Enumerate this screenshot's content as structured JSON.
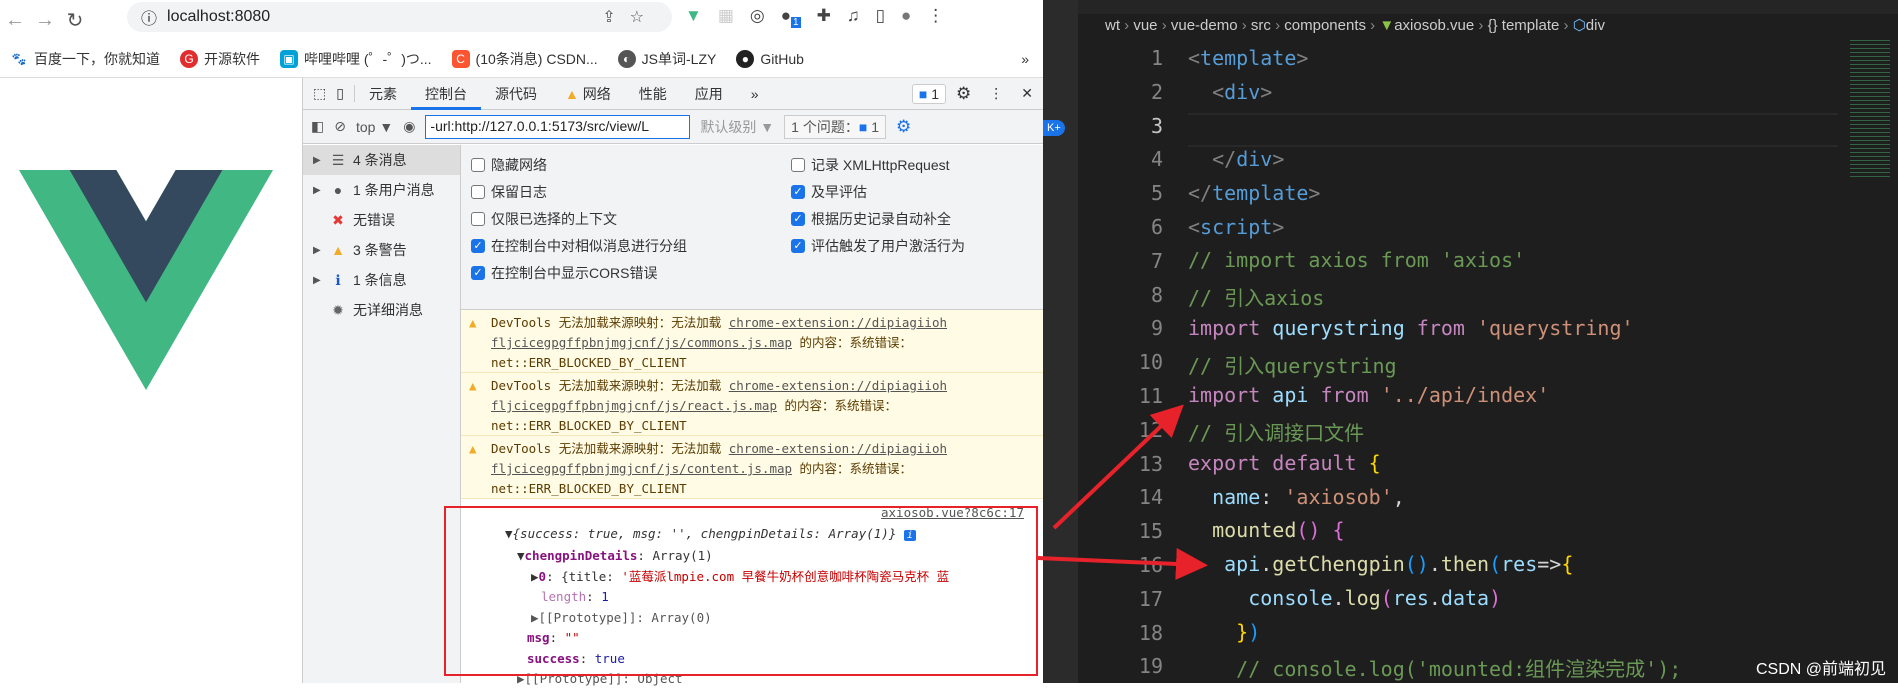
{
  "browser": {
    "url": "localhost:8080",
    "ext_badge": "1",
    "bookmarks": [
      "百度一下，你就知道",
      "开源软件",
      "哔哩哔哩 (゜-゜)つ...",
      "(10条消息) CSDN...",
      "JS单词-LZY",
      "GitHub"
    ],
    "more": "»"
  },
  "devtools": {
    "tabs": [
      "元素",
      "控制台",
      "源代码",
      "网络",
      "性能",
      "应用"
    ],
    "more_tabs": "»",
    "issues_badge": "1",
    "context": "top ▼",
    "filter_value": "-url:http://127.0.0.1:5173/src/view/L",
    "level": "默认级别 ▼",
    "issues_label": "1 个问题：",
    "issues_count": "1",
    "sidebar": [
      {
        "label": "4 条消息",
        "icon": "list-icon"
      },
      {
        "label": "1 条用户消息",
        "icon": "user-icon"
      },
      {
        "label": "无错误",
        "icon": "error-icon"
      },
      {
        "label": "3 条警告",
        "icon": "warning-icon"
      },
      {
        "label": "1 条信息",
        "icon": "info-icon"
      },
      {
        "label": "无详细消息",
        "icon": "bug-icon"
      }
    ],
    "settings": [
      {
        "label": "隐藏网络",
        "checked": false
      },
      {
        "label": "记录 XMLHttpRequest",
        "checked": false
      },
      {
        "label": "保留日志",
        "checked": false
      },
      {
        "label": "及早评估",
        "checked": true
      },
      {
        "label": "仅限已选择的上下文",
        "checked": false
      },
      {
        "label": "根据历史记录自动补全",
        "checked": true
      },
      {
        "label": "在控制台中对相似消息进行分组",
        "checked": true
      },
      {
        "label": "评估触发了用户激活行为",
        "checked": true
      },
      {
        "label": "在控制台中显示CORS错误",
        "checked": true
      }
    ],
    "warnings": [
      {
        "prefix": "DevTools 无法加载来源映射：无法加载 ",
        "link1": "chrome-extension://dipiagiioh",
        "link2": "fljcicegpgffpbnjmgjcnf/js/commons.js.map",
        "suffix": " 的内容：系统错误：",
        "error": "net::ERR_BLOCKED_BY_CLIENT"
      },
      {
        "prefix": "DevTools 无法加载来源映射：无法加载 ",
        "link1": "chrome-extension://dipiagiioh",
        "link2": "fljcicegpgffpbnjmgjcnf/js/react.js.map",
        "suffix": " 的内容：系统错误：",
        "error": "net::ERR_BLOCKED_BY_CLIENT"
      },
      {
        "prefix": "DevTools 无法加载来源映射：无法加载 ",
        "link1": "chrome-extension://dipiagiioh",
        "link2": "fljcicegpgffpbnjmgjcnf/js/content.js.map",
        "suffix": " 的内容：系统错误：",
        "error": "net::ERR_BLOCKED_BY_CLIENT"
      }
    ],
    "log": {
      "source": "axiosob.vue?8c6c:17",
      "summary": "{success: true, msg: '', chengpinDetails: Array(1)}",
      "chengpin_key": "chengpinDetails",
      "chengpin_val": "Array(1)",
      "item0_key": "0",
      "item0_val_prefix": "{title: ",
      "item0_title": "'蓝莓派lmpie.com 早餐牛奶杯创意咖啡杯陶瓷马克杯 蓝",
      "length_key": "length",
      "length_val": "1",
      "proto_arr": "[[Prototype]]: Array(0)",
      "msg_key": "msg",
      "msg_val": "\"\"",
      "success_key": "success",
      "success_val": "true",
      "proto_obj": "[[Prototype]]: Object"
    }
  },
  "editor": {
    "breadcrumb": [
      "wt",
      "vue",
      "vue-demo",
      "src",
      "components",
      "axiosob.vue",
      "template",
      "div"
    ],
    "line_numbers": [
      "1",
      "2",
      "3",
      "4",
      "5",
      "6",
      "7",
      "8",
      "9",
      "10",
      "11",
      "12",
      "13",
      "14",
      "15",
      "16",
      "17",
      "18",
      "19"
    ],
    "watermark": "CSDN @前端初见"
  }
}
